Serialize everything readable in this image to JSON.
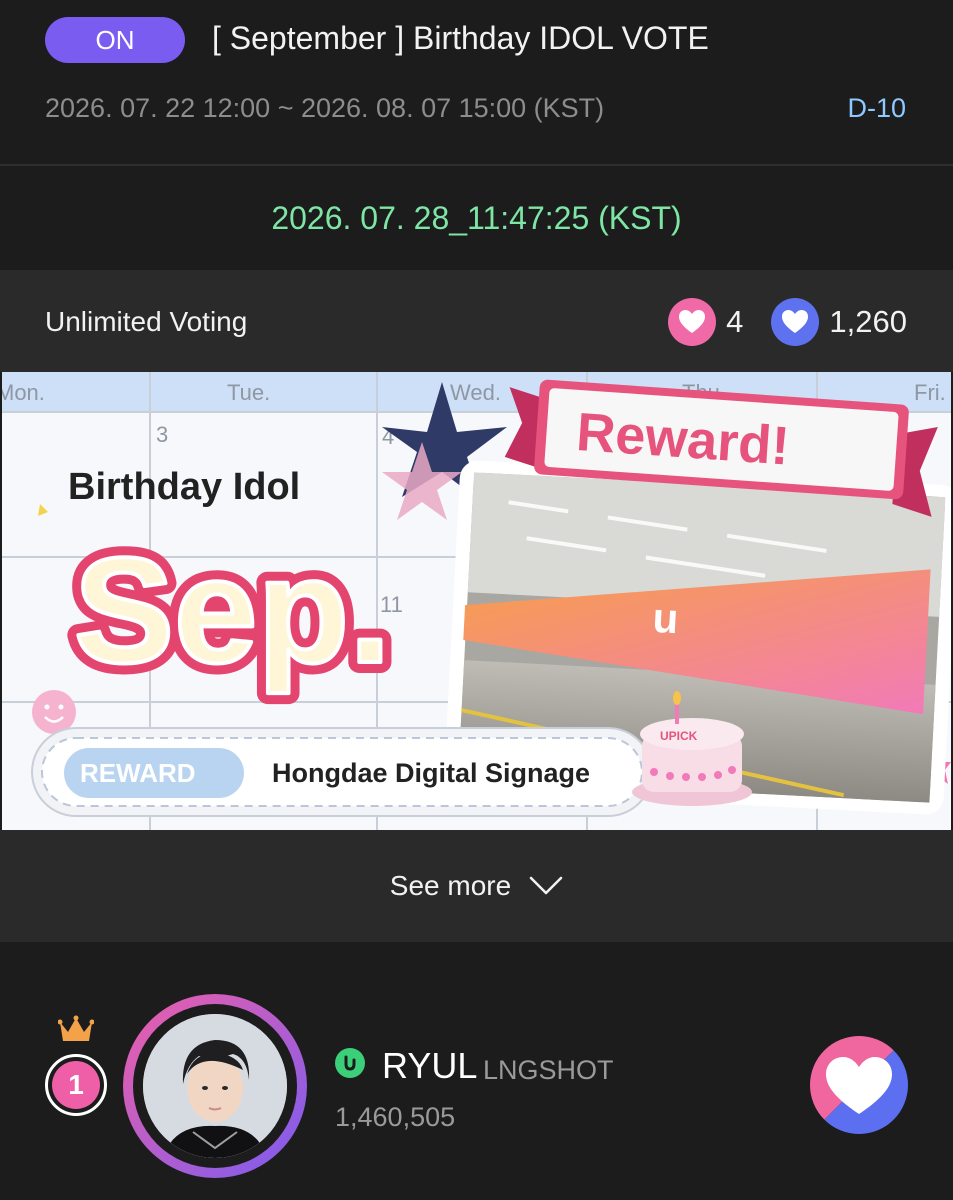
{
  "header": {
    "status": "ON",
    "title": "[ September ] Birthday IDOL VOTE",
    "period": "2026. 07. 22 12:00 ~ 2026. 08. 07 15:00 (KST)",
    "dday": "D-10"
  },
  "clock": "2026. 07. 28_11:47:25 (KST)",
  "info": {
    "voting_type": "Unlimited Voting",
    "pink_hearts": "4",
    "blue_hearts": "1,260"
  },
  "banner": {
    "days": [
      "Mon.",
      "Tue.",
      "Wed.",
      "Thu.",
      "Fri."
    ],
    "dates": [
      "3",
      "4",
      "11"
    ],
    "heading": "Birthday Idol",
    "month": "Sep.",
    "reward_ribbon": "Reward!",
    "reward_tag": "REWARD",
    "reward_place": "Hongdae Digital Signage",
    "cake_text": "UPICK"
  },
  "see_more": "See more",
  "ranking": [
    {
      "rank": "1",
      "name": "RYUL",
      "group": "LNGSHOT",
      "votes": "1,460,505"
    }
  ],
  "colors": {
    "accent_purple": "#7b5cf0",
    "pink": "#f06aa8",
    "blue": "#5e72f0",
    "clock_green": "#7ee6a5",
    "dday_blue": "#8ec9ff"
  }
}
